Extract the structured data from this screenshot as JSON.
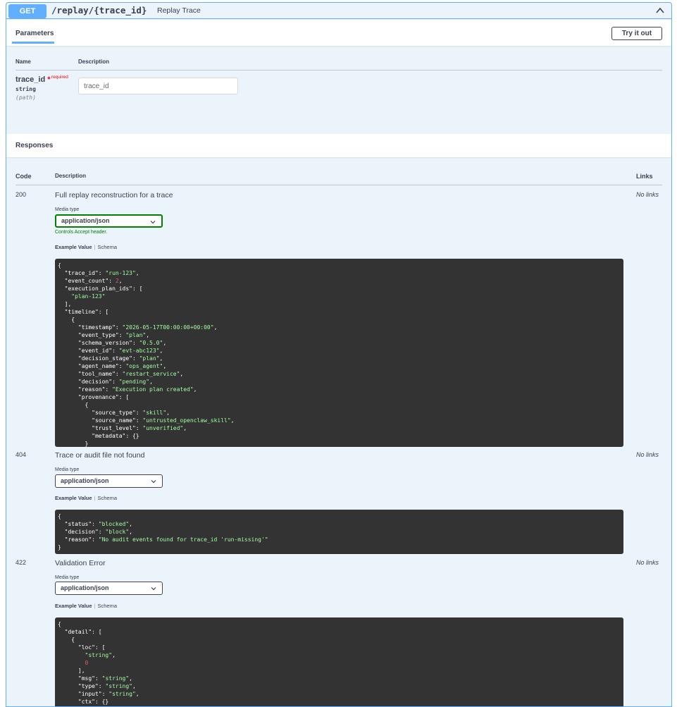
{
  "operation": {
    "method": "GET",
    "path": "/replay/{trace_id}",
    "summary": "Replay Trace",
    "accent_color": "#61affe"
  },
  "parameters": {
    "tab_label": "Parameters",
    "try_button": "Try it out",
    "col_name": "Name",
    "col_description": "Description",
    "items": [
      {
        "name": "trace_id",
        "required_star": "*",
        "required_label": "required",
        "type": "string",
        "in": "(path)",
        "placeholder": "trace_id"
      }
    ]
  },
  "responses": {
    "title": "Responses",
    "col_code": "Code",
    "col_description": "Description",
    "col_links": "Links",
    "media_type_label": "Media type",
    "controls_text": "Controls Accept header.",
    "example_tab": "Example Value",
    "schema_tab": "Schema",
    "tab_separator": "|",
    "items": [
      {
        "code": "200",
        "description": "Full replay reconstruction for a trace",
        "links": "No links",
        "media_type": "application/json",
        "example_lines": [
          [
            [
              "k",
              "{"
            ]
          ],
          [
            [
              "k",
              "  \"trace_id\": "
            ],
            [
              "s",
              "\"run-123\""
            ],
            [
              "k",
              ","
            ]
          ],
          [
            [
              "k",
              "  \"event_count\": "
            ],
            [
              "n",
              "2"
            ],
            [
              "k",
              ","
            ]
          ],
          [
            [
              "k",
              "  \"execution_plan_ids\": ["
            ]
          ],
          [
            [
              "s",
              "    \"plan-123\""
            ]
          ],
          [
            [
              "k",
              "  ],"
            ]
          ],
          [
            [
              "k",
              "  \"timeline\": ["
            ]
          ],
          [
            [
              "k",
              "    {"
            ]
          ],
          [
            [
              "k",
              "      \"timestamp\": "
            ],
            [
              "s",
              "\"2026-05-17T00:00:00+00:00\""
            ],
            [
              "k",
              ","
            ]
          ],
          [
            [
              "k",
              "      \"event_type\": "
            ],
            [
              "s",
              "\"plan\""
            ],
            [
              "k",
              ","
            ]
          ],
          [
            [
              "k",
              "      \"schema_version\": "
            ],
            [
              "s",
              "\"0.5.0\""
            ],
            [
              "k",
              ","
            ]
          ],
          [
            [
              "k",
              "      \"event_id\": "
            ],
            [
              "s",
              "\"evt-abc123\""
            ],
            [
              "k",
              ","
            ]
          ],
          [
            [
              "k",
              "      \"decision_stage\": "
            ],
            [
              "s",
              "\"plan\""
            ],
            [
              "k",
              ","
            ]
          ],
          [
            [
              "k",
              "      \"agent_name\": "
            ],
            [
              "s",
              "\"ops_agent\""
            ],
            [
              "k",
              ","
            ]
          ],
          [
            [
              "k",
              "      \"tool_name\": "
            ],
            [
              "s",
              "\"restart_service\""
            ],
            [
              "k",
              ","
            ]
          ],
          [
            [
              "k",
              "      \"decision\": "
            ],
            [
              "s",
              "\"pending\""
            ],
            [
              "k",
              ","
            ]
          ],
          [
            [
              "k",
              "      \"reason\": "
            ],
            [
              "s",
              "\"Execution plan created\""
            ],
            [
              "k",
              ","
            ]
          ],
          [
            [
              "k",
              "      \"provenance\": ["
            ]
          ],
          [
            [
              "k",
              "        {"
            ]
          ],
          [
            [
              "k",
              "          \"source_type\": "
            ],
            [
              "s",
              "\"skill\""
            ],
            [
              "k",
              ","
            ]
          ],
          [
            [
              "k",
              "          \"source_name\": "
            ],
            [
              "s",
              "\"untrusted_openclaw_skill\""
            ],
            [
              "k",
              ","
            ]
          ],
          [
            [
              "k",
              "          \"trust_level\": "
            ],
            [
              "s",
              "\"unverified\""
            ],
            [
              "k",
              ","
            ]
          ],
          [
            [
              "k",
              "          \"metadata\": {}"
            ]
          ],
          [
            [
              "k",
              "        }"
            ]
          ]
        ]
      },
      {
        "code": "404",
        "description": "Trace or audit file not found",
        "links": "No links",
        "media_type": "application/json",
        "example_lines": [
          [
            [
              "k",
              "{"
            ]
          ],
          [
            [
              "k",
              "  \"status\": "
            ],
            [
              "s",
              "\"blocked\""
            ],
            [
              "k",
              ","
            ]
          ],
          [
            [
              "k",
              "  \"decision\": "
            ],
            [
              "s",
              "\"block\""
            ],
            [
              "k",
              ","
            ]
          ],
          [
            [
              "k",
              "  \"reason\": "
            ],
            [
              "s",
              "\"No audit events found for trace_id 'run-missing'\""
            ]
          ],
          [
            [
              "k",
              "}"
            ]
          ]
        ]
      },
      {
        "code": "422",
        "description": "Validation Error",
        "links": "No links",
        "media_type": "application/json",
        "example_lines": [
          [
            [
              "k",
              "{"
            ]
          ],
          [
            [
              "k",
              "  \"detail\": ["
            ]
          ],
          [
            [
              "k",
              "    {"
            ]
          ],
          [
            [
              "k",
              "      \"loc\": ["
            ]
          ],
          [
            [
              "s",
              "        \"string\""
            ],
            [
              "k",
              ","
            ]
          ],
          [
            [
              "n",
              "        0"
            ]
          ],
          [
            [
              "k",
              "      ],"
            ]
          ],
          [
            [
              "k",
              "      \"msg\": "
            ],
            [
              "s",
              "\"string\""
            ],
            [
              "k",
              ","
            ]
          ],
          [
            [
              "k",
              "      \"type\": "
            ],
            [
              "s",
              "\"string\""
            ],
            [
              "k",
              ","
            ]
          ],
          [
            [
              "k",
              "      \"input\": "
            ],
            [
              "s",
              "\"string\""
            ],
            [
              "k",
              ","
            ]
          ],
          [
            [
              "k",
              "      \"ctx\": {}"
            ]
          ]
        ]
      }
    ]
  }
}
